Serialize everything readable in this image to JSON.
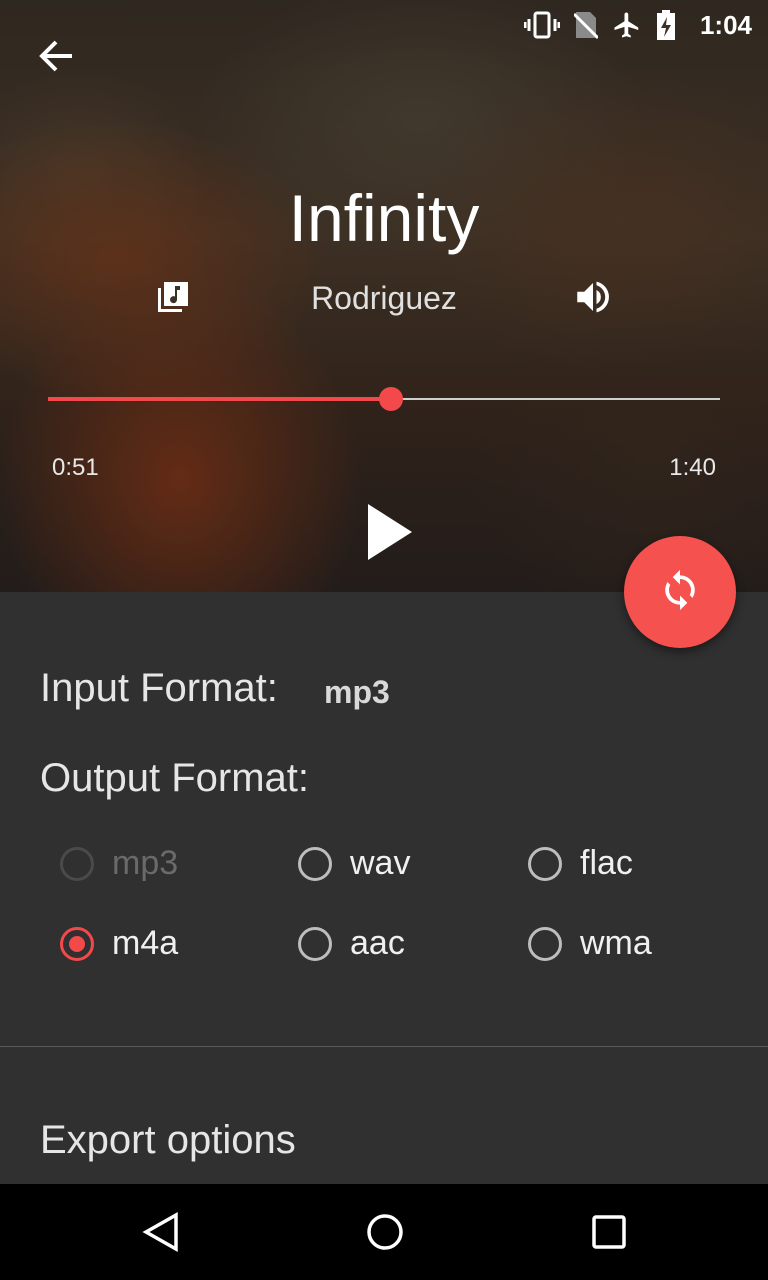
{
  "status_bar": {
    "time": "1:04",
    "icons": [
      "vibrate-icon",
      "no-sim-icon",
      "airplane-icon",
      "battery-charging-icon"
    ]
  },
  "toolbar": {
    "back_icon": "arrow-back-icon"
  },
  "track": {
    "title": "Infinity",
    "artist": "Rodriguez",
    "elapsed": "0:51",
    "duration": "1:40",
    "progress": 0.51
  },
  "fab": {
    "icon": "sync-icon",
    "color": "#f4514f"
  },
  "input_format": {
    "label": "Input Format:",
    "value": "mp3"
  },
  "output_format": {
    "label": "Output Format:",
    "options": [
      {
        "label": "mp3",
        "state": "disabled"
      },
      {
        "label": "wav",
        "state": "unchecked"
      },
      {
        "label": "flac",
        "state": "unchecked"
      },
      {
        "label": "m4a",
        "state": "checked"
      },
      {
        "label": "aac",
        "state": "unchecked"
      },
      {
        "label": "wma",
        "state": "unchecked"
      }
    ]
  },
  "export": {
    "label": "Export options"
  },
  "accent_color": "#f4494b",
  "navbar": {
    "icons": [
      "back-triangle-icon",
      "home-circle-icon",
      "recents-square-icon"
    ]
  }
}
